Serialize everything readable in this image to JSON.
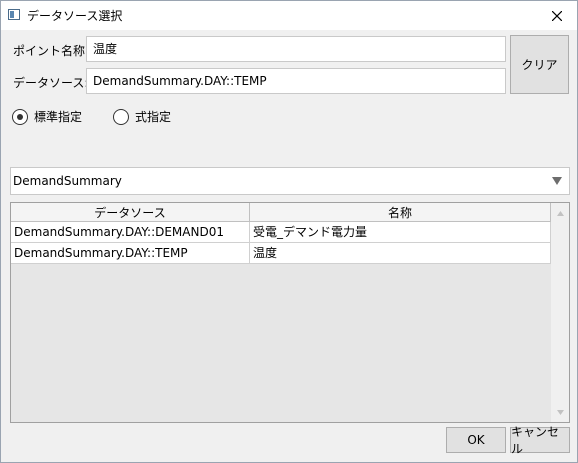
{
  "window": {
    "title": "データソース選択"
  },
  "form": {
    "point_name_label": "ポイント名称:",
    "point_name_value": "温度",
    "data_source_label": "データソース:",
    "data_source_value": "DemandSummary.DAY::TEMP",
    "clear_label": "クリア"
  },
  "mode": {
    "options": [
      {
        "label": "標準指定",
        "selected": true
      },
      {
        "label": "式指定",
        "selected": false
      }
    ]
  },
  "source_select": {
    "value": "DemandSummary"
  },
  "table": {
    "columns": [
      "データソース",
      "名称"
    ],
    "rows": [
      [
        "DemandSummary.DAY::DEMAND01",
        "受電_デマンド電力量"
      ],
      [
        "DemandSummary.DAY::TEMP",
        "温度"
      ]
    ]
  },
  "footer": {
    "ok_label": "OK",
    "cancel_label": "キャンセル"
  }
}
